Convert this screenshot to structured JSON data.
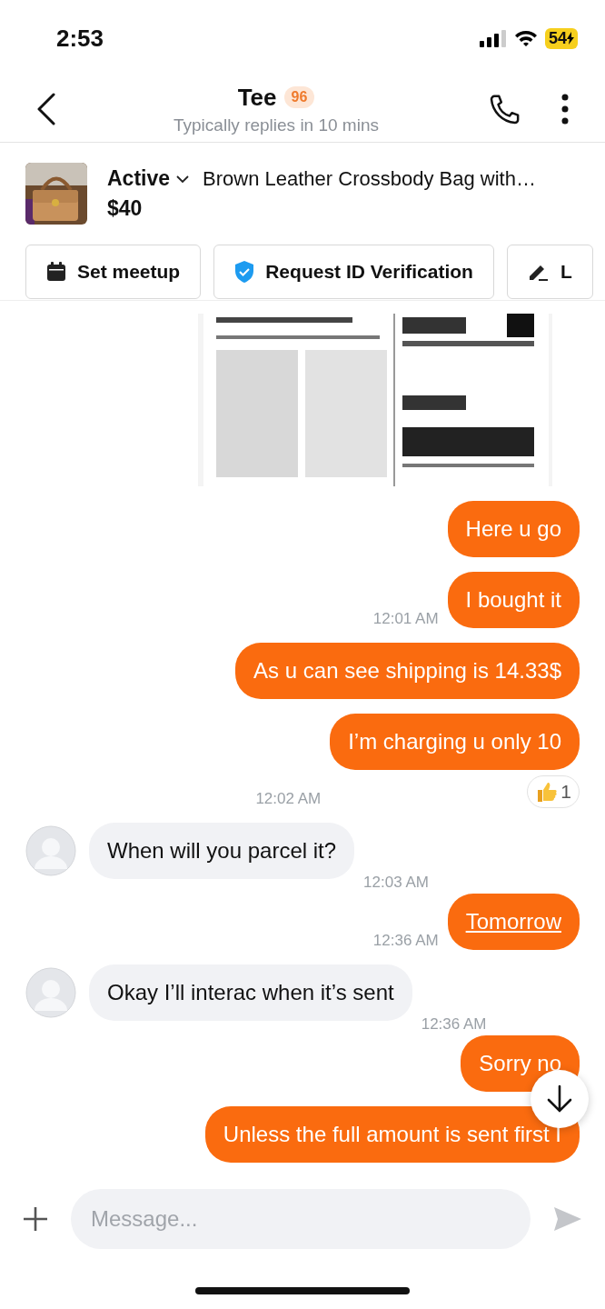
{
  "status_bar": {
    "time": "2:53",
    "battery": "54"
  },
  "header": {
    "name": "Tee",
    "badge": "96",
    "subtitle": "Typically replies in 10 mins"
  },
  "listing": {
    "status": "Active",
    "title": "Brown Leather Crossbody Bag with…",
    "price": "$40"
  },
  "actions": [
    {
      "label": "Set meetup",
      "kind": "calendar"
    },
    {
      "label": "Request ID Verification",
      "kind": "shield"
    },
    {
      "label": "L",
      "kind": "pen"
    }
  ],
  "messages": [
    {
      "kind": "picture"
    },
    {
      "kind": "outgoing",
      "text": "Here u go"
    },
    {
      "kind": "outgoing",
      "text": "I bought it",
      "time": "12:01 AM"
    },
    {
      "kind": "outgoing",
      "text": "As u can see shipping is 14.33$"
    },
    {
      "kind": "outgoing",
      "text": "I’m charging u only 10",
      "time": "12:02 AM",
      "reaction": "1"
    },
    {
      "kind": "incoming",
      "text": "When will you parcel it?",
      "time": "12:03 AM"
    },
    {
      "kind": "outgoing",
      "text": "Tomorrow",
      "time": "12:36 AM",
      "link": true
    },
    {
      "kind": "incoming",
      "text": "Okay I’ll interac when it’s sent",
      "time": "12:36 AM"
    },
    {
      "kind": "outgoing",
      "text": "Sorry no"
    },
    {
      "kind": "outgoing",
      "text": "Unless the full amount is sent first I"
    }
  ],
  "composer": {
    "placeholder": "Message..."
  }
}
